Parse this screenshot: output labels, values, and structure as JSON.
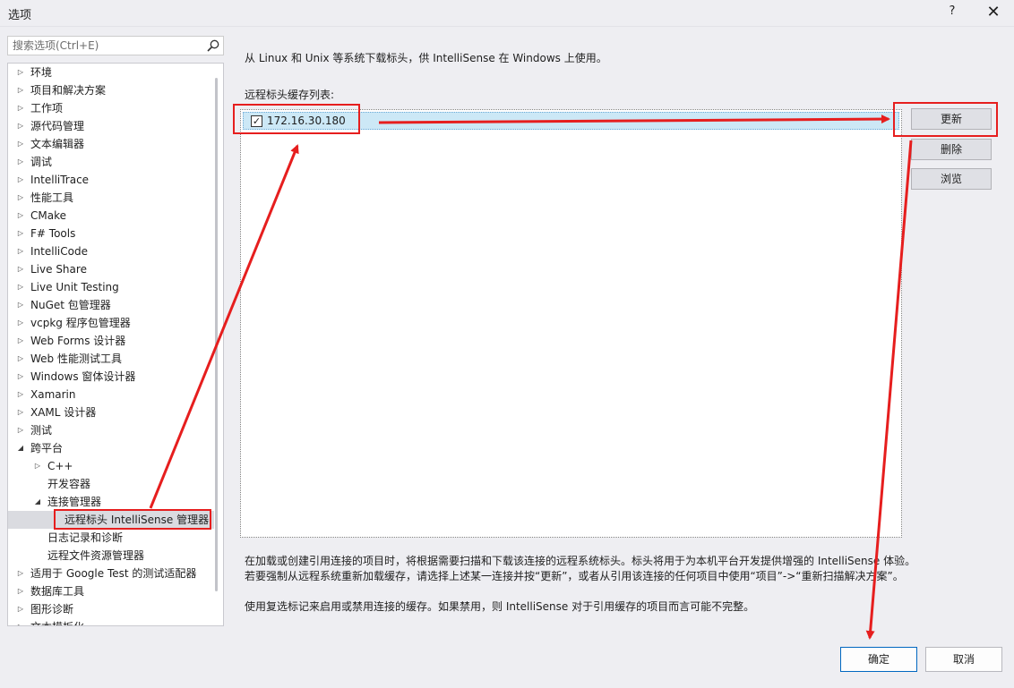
{
  "window": {
    "title": "选项",
    "help_label": "?",
    "close_label": "✕"
  },
  "search": {
    "placeholder": "搜索选项(Ctrl+E)"
  },
  "tree": {
    "items": [
      {
        "label": "环境",
        "arrow": "right"
      },
      {
        "label": "项目和解决方案",
        "arrow": "right"
      },
      {
        "label": "工作项",
        "arrow": "right"
      },
      {
        "label": "源代码管理",
        "arrow": "right"
      },
      {
        "label": "文本编辑器",
        "arrow": "right"
      },
      {
        "label": "调试",
        "arrow": "right"
      },
      {
        "label": "IntelliTrace",
        "arrow": "right"
      },
      {
        "label": "性能工具",
        "arrow": "right"
      },
      {
        "label": "CMake",
        "arrow": "right"
      },
      {
        "label": "F# Tools",
        "arrow": "right"
      },
      {
        "label": "IntelliCode",
        "arrow": "right"
      },
      {
        "label": "Live Share",
        "arrow": "right"
      },
      {
        "label": "Live Unit Testing",
        "arrow": "right"
      },
      {
        "label": "NuGet 包管理器",
        "arrow": "right"
      },
      {
        "label": "vcpkg 程序包管理器",
        "arrow": "right"
      },
      {
        "label": "Web Forms 设计器",
        "arrow": "right"
      },
      {
        "label": "Web 性能测试工具",
        "arrow": "right"
      },
      {
        "label": "Windows 窗体设计器",
        "arrow": "right"
      },
      {
        "label": "Xamarin",
        "arrow": "right"
      },
      {
        "label": "XAML 设计器",
        "arrow": "right"
      },
      {
        "label": "测试",
        "arrow": "right"
      },
      {
        "label": "跨平台",
        "arrow": "down"
      },
      {
        "label": "C++",
        "arrow": "right"
      },
      {
        "label": "开发容器",
        "arrow": "none"
      },
      {
        "label": "连接管理器",
        "arrow": "down"
      },
      {
        "label": "远程标头 IntelliSense 管理器",
        "arrow": "none",
        "selected": true
      },
      {
        "label": "日志记录和诊断",
        "arrow": "none"
      },
      {
        "label": "远程文件资源管理器",
        "arrow": "none"
      },
      {
        "label": "适用于 Google Test 的测试适配器",
        "arrow": "right"
      },
      {
        "label": "数据库工具",
        "arrow": "right"
      },
      {
        "label": "图形诊断",
        "arrow": "right"
      },
      {
        "label": "文本模板化",
        "arrow": "right"
      }
    ]
  },
  "content": {
    "description_top": "从 Linux 和 Unix 等系统下载标头，供 IntelliSense 在 Windows 上使用。",
    "list_label": "远程标头缓存列表:",
    "hosts": [
      {
        "address": "172.16.30.180",
        "checked": true
      }
    ],
    "buttons": {
      "update": "更新",
      "delete": "删除",
      "browse": "浏览"
    },
    "description_bottom": [
      "在加载或创建引用连接的项目时，将根据需要扫描和下载该连接的远程系统标头。标头将用于为本机平台开发提供增强的 IntelliSense 体验。",
      "若要强制从远程系统重新加载缓存，请选择上述某一连接并按“更新”，或者从引用该连接的任何项目中使用“项目”->“重新扫描解决方案”。",
      "使用复选标记来启用或禁用连接的缓存。如果禁用，则 IntelliSense 对于引用缓存的项目而言可能不完整。"
    ]
  },
  "footer": {
    "ok": "确定",
    "cancel": "取消"
  },
  "colors": {
    "annotation": "#e61e1e",
    "selection": "#cce8f6",
    "primary_border": "#0067c0"
  }
}
